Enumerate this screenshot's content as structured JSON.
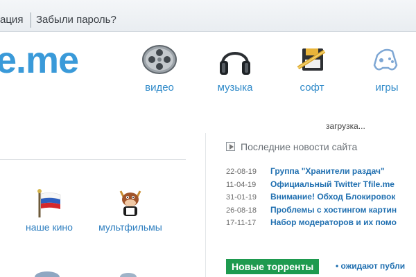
{
  "topbar": {
    "registration_label": "ация",
    "forgot_password_label": "Забыли пароль?"
  },
  "logo": {
    "text": "e.me"
  },
  "nav": [
    {
      "id": "video",
      "label": "видео",
      "icon": "film-reel-icon"
    },
    {
      "id": "music",
      "label": "музыка",
      "icon": "headphones-icon"
    },
    {
      "id": "soft",
      "label": "софт",
      "icon": "floppy-disk-icon"
    },
    {
      "id": "games",
      "label": "игры",
      "icon": "gamepad-icon"
    }
  ],
  "loading_text": "загрузка...",
  "categories": [
    {
      "label": "наше кино",
      "icon": "russian-flag-icon"
    },
    {
      "label": "мультфильмы",
      "icon": "cartoon-cow-icon"
    }
  ],
  "news": {
    "heading": "Последние новости сайта",
    "items": [
      {
        "date": "22-08-19",
        "title": "Группа \"Хранители раздач\""
      },
      {
        "date": "11-04-19",
        "title": "Официальный Twitter Tfile.me"
      },
      {
        "date": "31-01-19",
        "title": "Внимание! Обход Блокировок"
      },
      {
        "date": "26-08-18",
        "title": "Проблемы с хостингом картин"
      },
      {
        "date": "17-11-17",
        "title": "Набор модераторов и их помо"
      }
    ]
  },
  "torrents": {
    "button_label": "Новые торренты",
    "note": "• ожидают публи"
  },
  "colors": {
    "accent": "#3a9ad9",
    "link": "#2f7fc0",
    "torrents_bg": "#1e9a4f"
  }
}
